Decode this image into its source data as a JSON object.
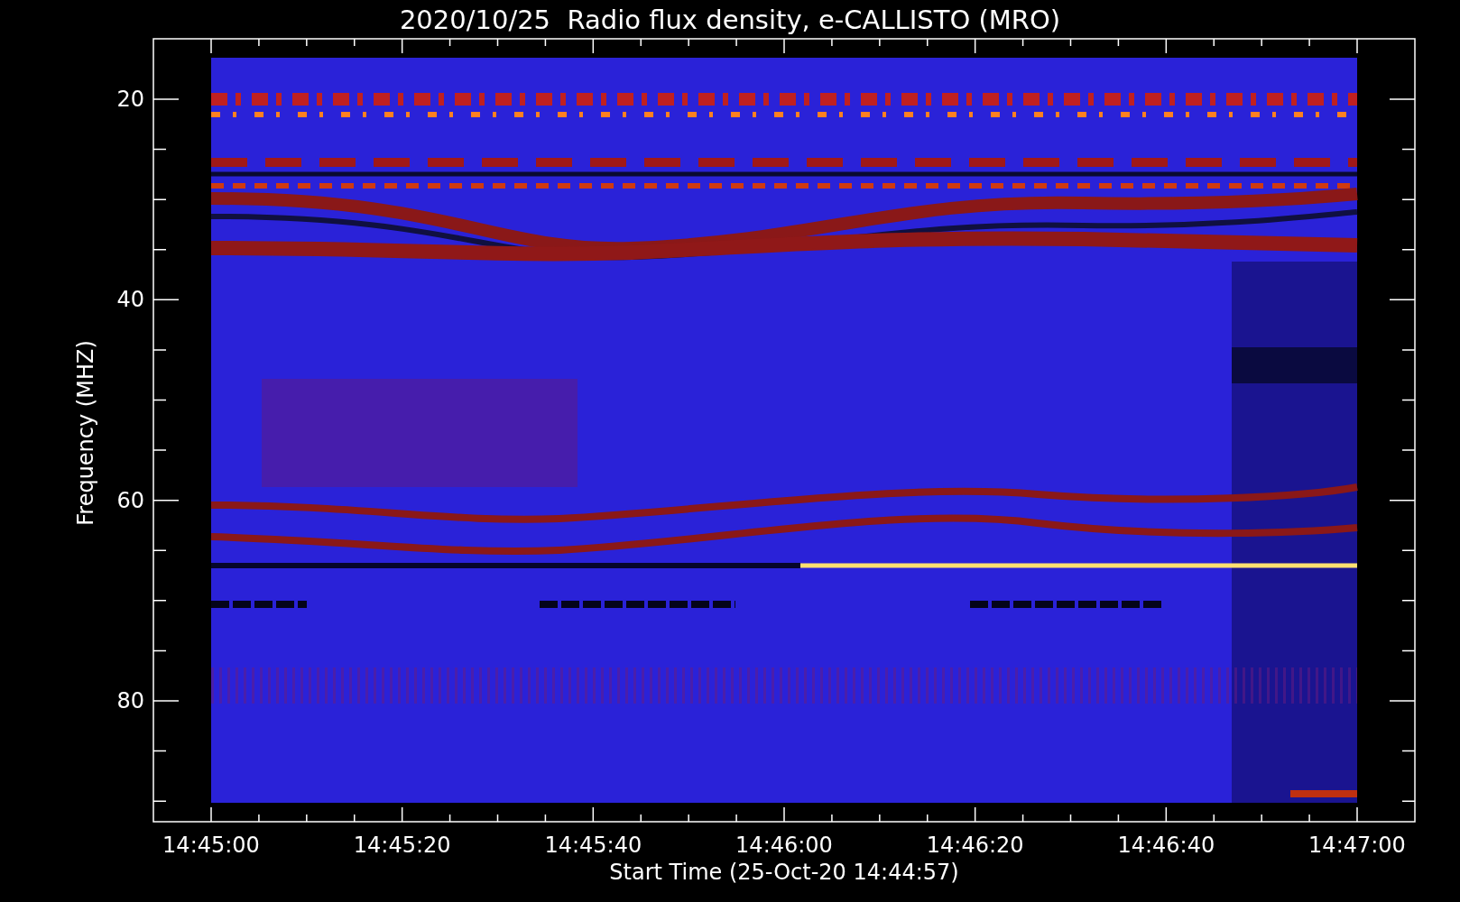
{
  "title": "2020/10/25  Radio flux density, e-CALLISTO (MRO)",
  "y_axis": {
    "label": "Frequency (MHZ)",
    "ticks": [
      "20",
      "40",
      "60",
      "80"
    ]
  },
  "x_axis": {
    "label": "Start Time (25-Oct-20 14:44:57)",
    "ticks": [
      "14:45:00",
      "14:45:20",
      "14:45:40",
      "14:46:00",
      "14:46:20",
      "14:46:40",
      "14:47:00"
    ]
  }
}
